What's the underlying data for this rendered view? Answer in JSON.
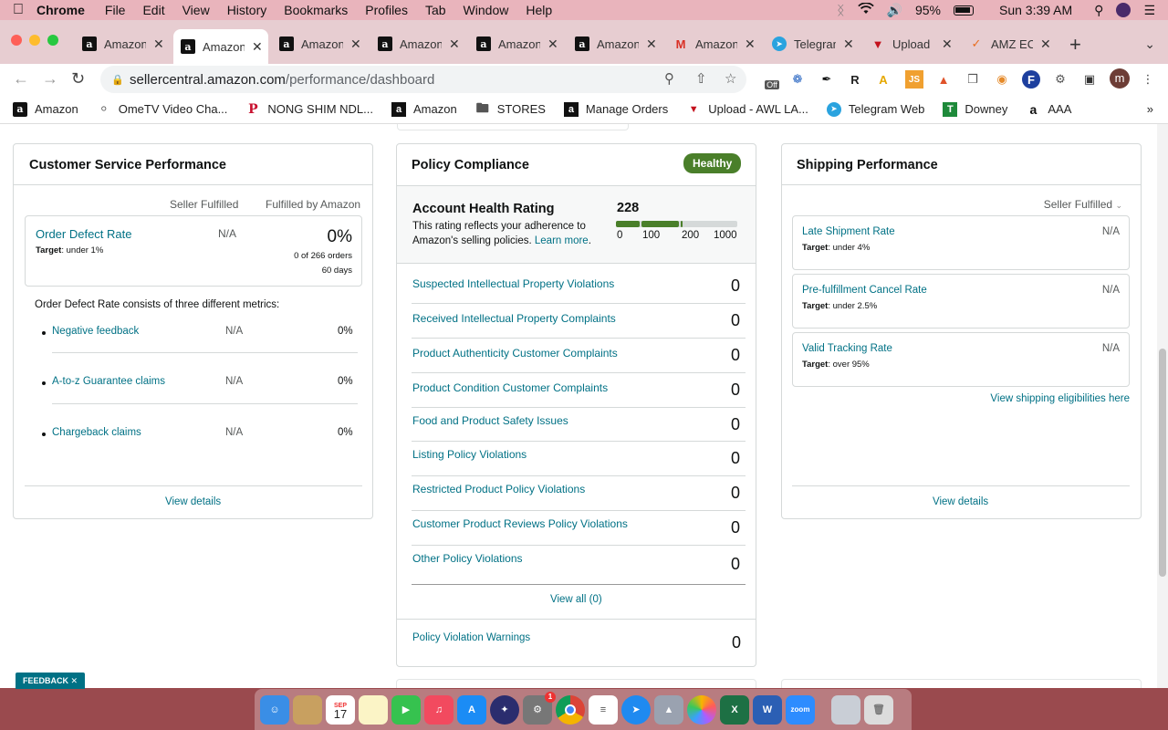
{
  "menubar": {
    "app": "Chrome",
    "menus": [
      "File",
      "Edit",
      "View",
      "History",
      "Bookmarks",
      "Profiles",
      "Tab",
      "Window",
      "Help"
    ],
    "battery": "95%",
    "clock": "Sun 3:39 AM"
  },
  "tabs": [
    {
      "title": "Amazon",
      "icon": "amazon-icon"
    },
    {
      "title": "Amazon",
      "icon": "amazon-icon",
      "active": true
    },
    {
      "title": "Amazon",
      "icon": "amazon-icon"
    },
    {
      "title": "Amazon",
      "icon": "amazon-icon"
    },
    {
      "title": "Amazon",
      "icon": "amazon-icon"
    },
    {
      "title": "Amazon",
      "icon": "amazon-icon"
    },
    {
      "title": "Amazon",
      "icon": "gmail-icon"
    },
    {
      "title": "Telegram",
      "icon": "telegram-icon"
    },
    {
      "title": "Upload",
      "icon": "upload-icon"
    },
    {
      "title": "AMZ EC",
      "icon": "amz-ec-icon"
    }
  ],
  "address": {
    "host": "sellercentral.amazon.com",
    "path": "/performance/dashboard"
  },
  "extensions": {
    "off_badge": "Off",
    "profile_initial": "m"
  },
  "bookmarks": [
    "Amazon",
    "OmeTV Video Cha...",
    "NONG SHIM NDL...",
    "Amazon",
    "STORES",
    "Manage Orders",
    "Upload - AWL LA...",
    "Telegram Web",
    "Downey",
    "AAA"
  ],
  "customer_service": {
    "title": "Customer Service Performance",
    "col_seller": "Seller Fulfilled",
    "col_fba": "Fulfilled by Amazon",
    "odr_label": "Order Defect Rate",
    "odr_target_prefix": "Target",
    "odr_target": ": under 1%",
    "odr_seller": "N/A",
    "odr_fba": "0%",
    "odr_orders": "0 of 266 orders",
    "odr_days": "60 days",
    "metrics_intro": "Order Defect Rate consists of three different metrics:",
    "metrics": [
      {
        "label": "Negative feedback",
        "seller": "N/A",
        "fba": "0%"
      },
      {
        "label": "A-to-z Guarantee claims",
        "seller": "N/A",
        "fba": "0%"
      },
      {
        "label": "Chargeback claims",
        "seller": "N/A",
        "fba": "0%"
      }
    ],
    "view_details": "View details"
  },
  "policy": {
    "title": "Policy Compliance",
    "status": "Healthy",
    "ahr_title": "Account Health Rating",
    "ahr_desc_1": "This rating reflects your adherence to",
    "ahr_desc_2": "Amazon's selling policies.",
    "learn_more": "Learn more",
    "score": "228",
    "scale": [
      "0",
      "100",
      "200",
      "1000"
    ],
    "rows": [
      {
        "label": "Suspected Intellectual Property Violations",
        "count": "0"
      },
      {
        "label": "Received Intellectual Property Complaints",
        "count": "0"
      },
      {
        "label": "Product Authenticity Customer Complaints",
        "count": "0"
      },
      {
        "label": "Product Condition Customer Complaints",
        "count": "0"
      },
      {
        "label": "Food and Product Safety Issues",
        "count": "0"
      },
      {
        "label": "Listing Policy Violations",
        "count": "0"
      },
      {
        "label": "Restricted Product Policy Violations",
        "count": "0"
      },
      {
        "label": "Customer Product Reviews Policy Violations",
        "count": "0"
      },
      {
        "label": "Other Policy Violations",
        "count": "0"
      }
    ],
    "view_all": "View all (0)",
    "warnings_label": "Policy Violation Warnings",
    "warnings_count": "0"
  },
  "shipping": {
    "title": "Shipping Performance",
    "filter": "Seller Fulfilled",
    "rows": [
      {
        "label": "Late Shipment Rate",
        "target_prefix": "Target",
        "target": ": under 4%",
        "value": "N/A"
      },
      {
        "label": "Pre-fulfillment Cancel Rate",
        "target_prefix": "Target",
        "target": ": under 2.5%",
        "value": "N/A"
      },
      {
        "label": "Valid Tracking Rate",
        "target_prefix": "Target",
        "target": ": over 95%",
        "value": "N/A"
      }
    ],
    "eligibility_link": "View shipping eligibilities here",
    "view_details": "View details"
  },
  "feedback": "FEEDBACK",
  "dock": {
    "calendar_month": "SEP",
    "calendar_day": "17",
    "zoom_label": "zoom",
    "settings_badge": "1"
  }
}
